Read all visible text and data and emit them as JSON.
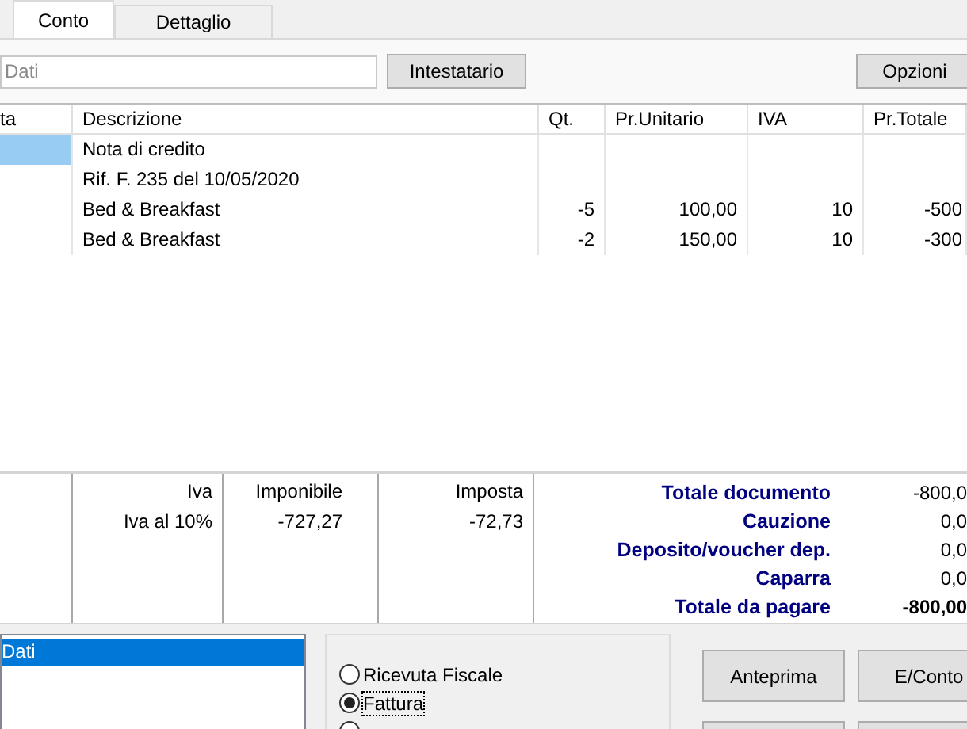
{
  "tabs": [
    {
      "label": "Conto",
      "selected": true
    },
    {
      "label": "Dettaglio",
      "selected": false
    }
  ],
  "toolbar": {
    "field": {
      "placeholder": "Dati"
    },
    "buttons": [
      {
        "label": "Intestatario"
      },
      {
        "label": "Opzioni"
      }
    ]
  },
  "table": {
    "columns": [
      "ta",
      "Descrizione",
      "Qt.",
      "Pr.Unitario",
      "IVA",
      "Pr.Totale"
    ],
    "rows": [
      {
        "selected": true,
        "descrizione": "Nota di credito"
      },
      {
        "selected": false,
        "descrizione": "Rif. F. 235 del 10/05/2020"
      },
      {
        "selected": false,
        "descrizione": "Bed & Breakfast",
        "qt": "-5",
        "pr_unitario": "100,00",
        "iva": "10",
        "pr_totale": "-500"
      },
      {
        "selected": false,
        "descrizione": "Bed & Breakfast",
        "qt": "-2",
        "pr_unitario": "150,00",
        "iva": "10",
        "pr_totale": "-300"
      }
    ]
  },
  "vat_summary": {
    "columns": [
      "Iva",
      "Imponibile",
      "Imposta"
    ],
    "rows": [
      {
        "iva": "Iva al 10%",
        "imponibile": "-727,27",
        "imposta": "-72,73"
      }
    ]
  },
  "totals": [
    {
      "kind": "line",
      "label": "Totale documento",
      "value": "-800,0"
    },
    {
      "kind": "line",
      "label": "Cauzione",
      "value": "0,0"
    },
    {
      "kind": "line",
      "label": "Deposito/voucher dep.",
      "value": "0,0"
    },
    {
      "kind": "line",
      "label": "Caparra",
      "value": "0,0"
    },
    {
      "kind": "grand_total",
      "label": "Totale da pagare",
      "value": "-800,00"
    }
  ],
  "list": [
    {
      "label": "Dati",
      "selected": true
    }
  ],
  "document_types": [
    {
      "label": "Ricevuta Fiscale",
      "selected": false
    },
    {
      "label": "Fattura",
      "selected": true
    },
    {
      "selected": false
    }
  ],
  "buttons": [
    {
      "kind": "full",
      "label": "Anteprima"
    },
    {
      "kind": "full",
      "label": "E/Conto"
    },
    {
      "kind": "cut"
    },
    {
      "kind": "cut"
    }
  ]
}
